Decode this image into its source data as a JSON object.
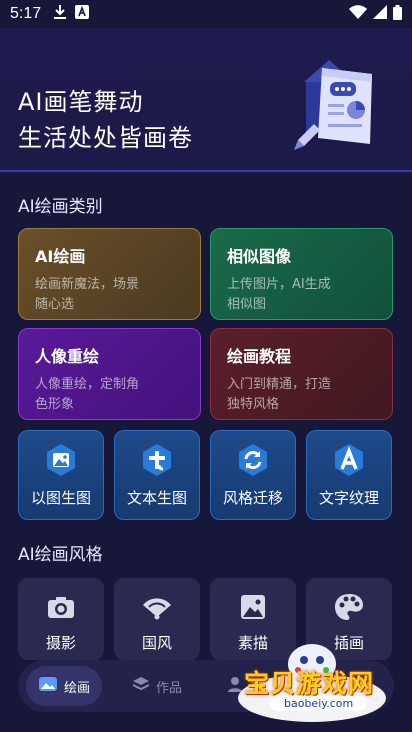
{
  "status_bar": {
    "time": "5:17"
  },
  "hero": {
    "line1": "AI画笔舞动",
    "line2": "生活处处皆画卷"
  },
  "categories": {
    "title": "AI绘画类别",
    "cards": [
      {
        "title": "AI绘画",
        "desc": "绘画新魔法，场景\n随心选"
      },
      {
        "title": "相似图像",
        "desc": "上传图片，AI生成\n相似图"
      },
      {
        "title": "人像重绘",
        "desc": "人像重绘，定制角\n色形象"
      },
      {
        "title": "绘画教程",
        "desc": "入门到精通，打造\n独特风格"
      }
    ]
  },
  "tools": [
    {
      "label": "以图生图",
      "icon": "image-icon"
    },
    {
      "label": "文本生图",
      "icon": "text-t-icon"
    },
    {
      "label": "风格迁移",
      "icon": "refresh-icon"
    },
    {
      "label": "文字纹理",
      "icon": "letter-a-icon"
    }
  ],
  "styles": {
    "title": "AI绘画风格",
    "items": [
      {
        "label": "摄影",
        "icon": "camera-icon"
      },
      {
        "label": "国风",
        "icon": "fan-icon"
      },
      {
        "label": "素描",
        "icon": "picture-icon"
      },
      {
        "label": "插画",
        "icon": "palette-icon"
      }
    ]
  },
  "bottom_nav": {
    "tabs": [
      {
        "label": "绘画",
        "active": true
      },
      {
        "label": "作品",
        "active": false
      },
      {
        "label": "我的",
        "active": false
      }
    ]
  },
  "watermark": {
    "text": "宝贝游戏网",
    "url": "baobeiy.com"
  }
}
